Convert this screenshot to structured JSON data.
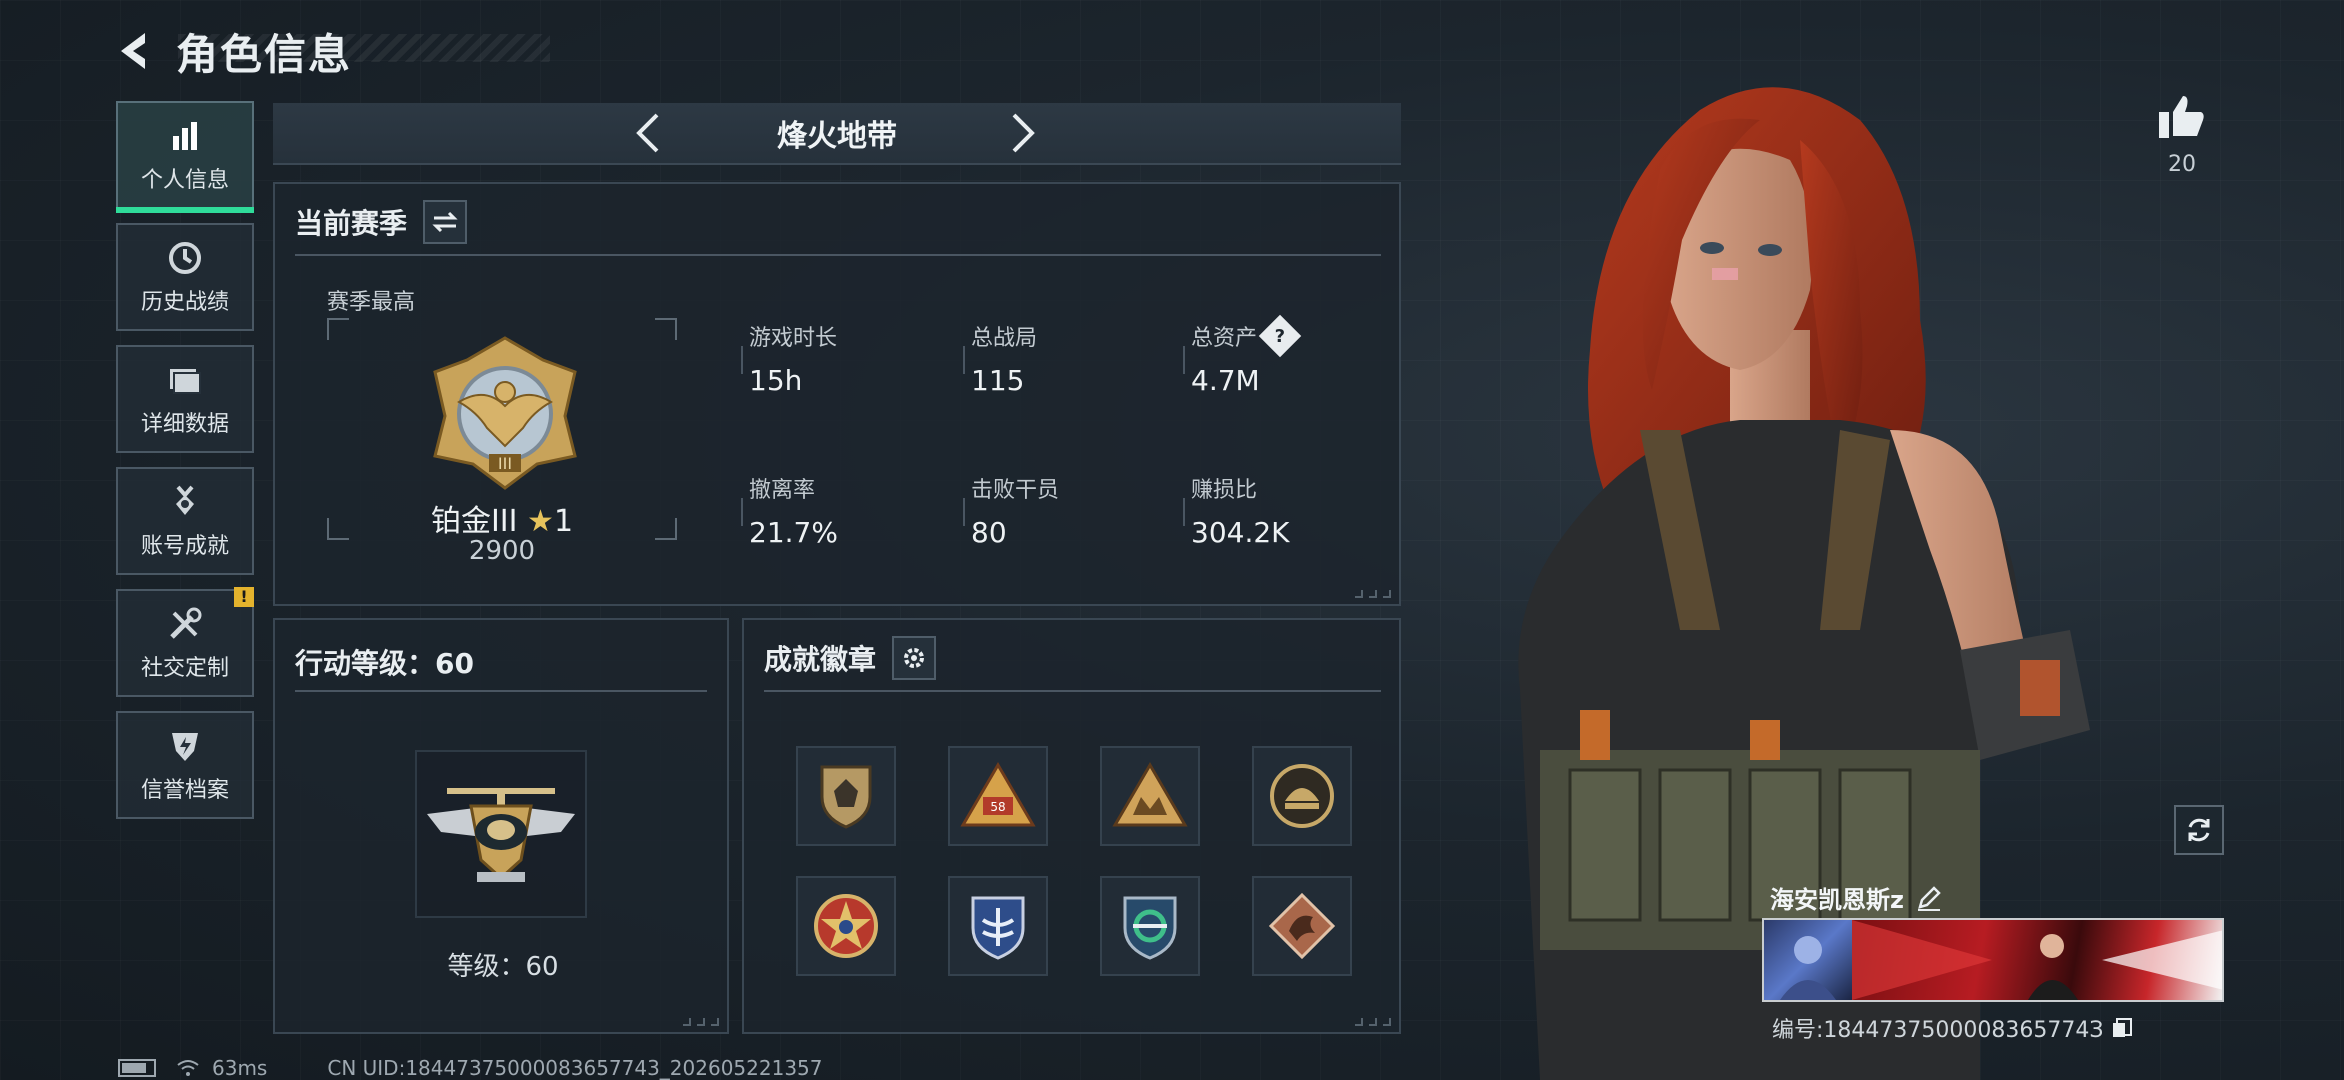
{
  "header": {
    "title": "角色信息"
  },
  "sidebar": {
    "items": [
      {
        "label": "个人信息",
        "icon": "bar-chart-icon",
        "active": true
      },
      {
        "label": "历史战绩",
        "icon": "history-icon"
      },
      {
        "label": "详细数据",
        "icon": "folder-icon"
      },
      {
        "label": "账号成就",
        "icon": "medal-icon"
      },
      {
        "label": "社交定制",
        "icon": "tools-icon",
        "alert": "!"
      },
      {
        "label": "信誉档案",
        "icon": "shield-bolt-icon"
      }
    ]
  },
  "mode": {
    "name": "烽火地带"
  },
  "season": {
    "title": "当前赛季",
    "best_label": "赛季最高",
    "rank_name": "铂金III",
    "rank_star": "★",
    "rank_stars": "1",
    "rank_score": "2900",
    "stats": [
      {
        "label": "游戏时长",
        "value": "15h"
      },
      {
        "label": "总战局",
        "value": "115"
      },
      {
        "label": "总资产",
        "value": "4.7M",
        "help": "?"
      },
      {
        "label": "撤离率",
        "value": "21.7%"
      },
      {
        "label": "击败干员",
        "value": "80"
      },
      {
        "label": "赚损比",
        "value": "304.2K"
      }
    ]
  },
  "level": {
    "title": "行动等级：60",
    "caption": "等级：60"
  },
  "achievements": {
    "title": "成就徽章",
    "badges": [
      "shield-badge-icon",
      "triangle-58-badge-icon",
      "triangle-crest-badge-icon",
      "helmet-badge-icon",
      "star-badge-icon",
      "wing-shield-badge-icon",
      "swirl-shield-badge-icon",
      "dragon-badge-icon"
    ]
  },
  "likes": {
    "count": "20"
  },
  "player": {
    "name": "海安凯恩斯z",
    "id_label": "编号:1844737500008365774З"
  },
  "status": {
    "ping": "63ms",
    "uid": "CN UID:18447375000083657743_202605221357"
  },
  "colors": {
    "accent": "#2fdc9a",
    "warn": "#e4b32d",
    "bg": "#1c252d"
  }
}
